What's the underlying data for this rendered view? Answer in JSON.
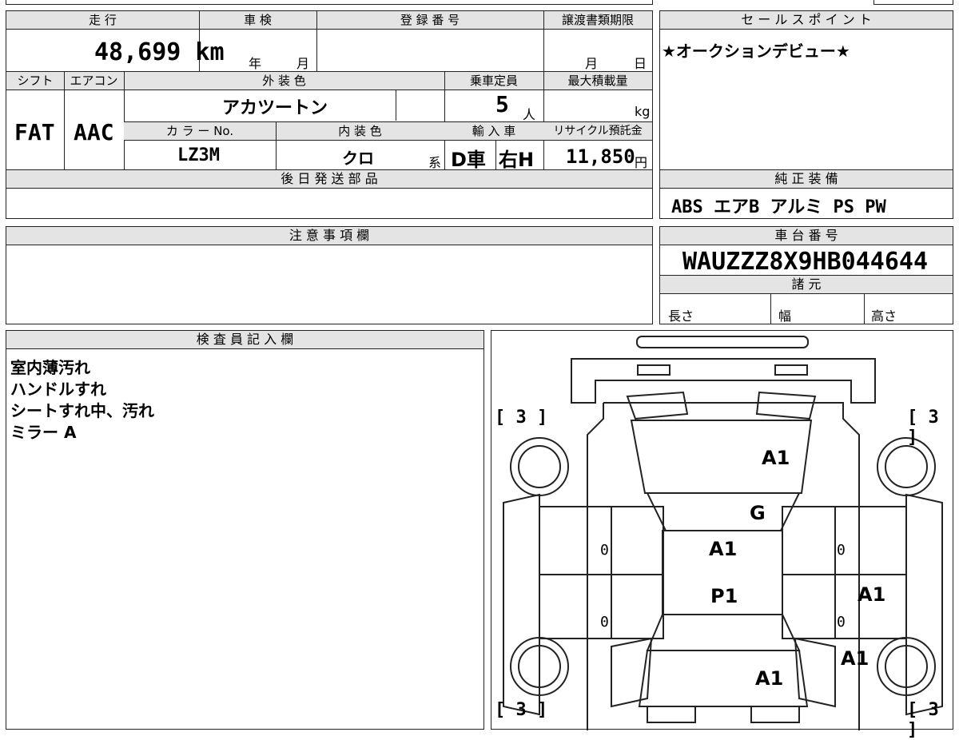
{
  "vehicle": {
    "mileage_header": "走 行",
    "mileage": "48,699 km",
    "inspection_header": "車 検",
    "inspection_year_label": "年",
    "inspection_month_label": "月",
    "registration_header": "登 録 番 号",
    "transfer_deadline_header": "譲渡書類期限",
    "transfer_month_label": "月",
    "transfer_day_label": "日",
    "shift_header": "シフト",
    "shift": "FAT",
    "aircon_header": "エアコン",
    "aircon": "AAC",
    "exterior_color_header": "外 装 色",
    "exterior_color": "アカツートン",
    "capacity_header": "乗車定員",
    "capacity": "5",
    "capacity_unit": "人",
    "max_load_header": "最大積載量",
    "max_load_unit": "kg",
    "color_no_header": "カ ラ ー No.",
    "color_no": "LZ3M",
    "interior_color_header": "内 装 色",
    "interior_color": "クロ",
    "interior_suffix": "系",
    "import_header": "輸 入 車",
    "import_type": "D車",
    "steering": "右H",
    "recycle_header": "リサイクル預託金",
    "recycle_fee": "11,850",
    "recycle_unit": "円"
  },
  "later_parts": {
    "header": "後 日 発 送 部 品",
    "content": ""
  },
  "notes": {
    "header": "注 意 事 項 欄",
    "content": ""
  },
  "sales_point": {
    "header": "セ ー ル ス ポ イ ン ト",
    "content": "★オークションデビュー★"
  },
  "standard_equipment": {
    "header": "純 正 装 備",
    "content": "ABS エアB アルミ PS PW"
  },
  "chassis": {
    "header": "車 台 番 号",
    "number": "WAUZZZ8X9HB044644"
  },
  "specs": {
    "header": "諸 元",
    "length_label": "長さ",
    "width_label": "幅",
    "height_label": "高さ"
  },
  "inspector": {
    "header": "検 査 員 記 入 欄",
    "lines": [
      "室内薄汚れ",
      "ハンドルすれ",
      "シートすれ中、汚れ",
      "ミラー A"
    ]
  },
  "diagram": {
    "tire_fl": "[ 3 ]",
    "tire_fr": "[ 3 ]",
    "tire_rl": "[ 3 ]",
    "tire_rr": "[ 3 ]",
    "hood": "A1",
    "windshield": "G",
    "roof_front": "A1",
    "roof_rear": "P1",
    "right_rear_door": "A1",
    "right_quarter": "A1",
    "trunk": "A1",
    "left_front_door_zero": "0",
    "left_rear_door_zero": "0",
    "right_front_door_zero": "0",
    "right_rear_door_zero": "0"
  }
}
